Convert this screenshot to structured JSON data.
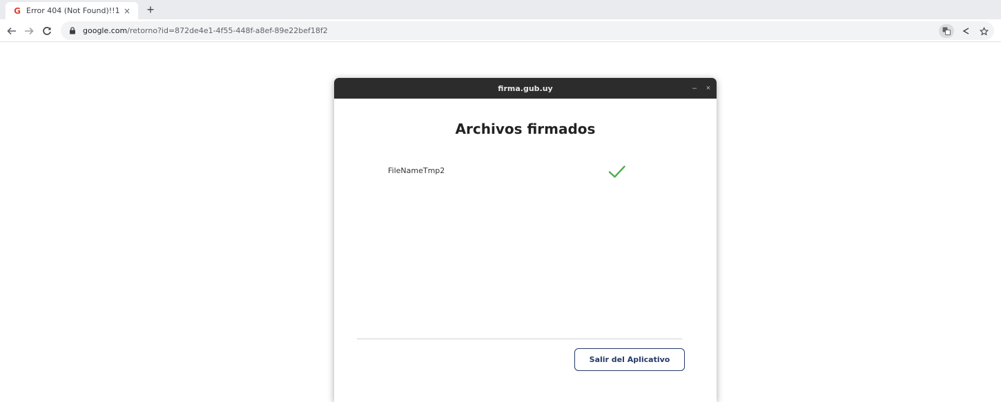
{
  "browser": {
    "tab": {
      "favicon_letter": "G",
      "title": "Error 404 (Not Found)!!1",
      "close_glyph": "×"
    },
    "new_tab_glyph": "+",
    "nav": {
      "back_icon": "arrow-left-icon",
      "forward_icon": "arrow-right-icon",
      "reload_icon": "reload-icon"
    },
    "url": {
      "host": "google.com",
      "path": "/retorno?id=872de4e1-4f55-448f-a8ef-89e22bef18f2"
    },
    "omnibox_icons": [
      "translate-icon",
      "share-icon",
      "star-icon"
    ]
  },
  "dialog": {
    "window_title": "firma.gub.uy",
    "minimize_glyph": "–",
    "close_glyph": "×",
    "heading": "Archivos firmados",
    "files": [
      {
        "name": "FileNameTmp2",
        "status": "signed",
        "status_icon": "checkmark-icon",
        "status_color": "#4caf50"
      }
    ],
    "exit_button_label": "Salir del Aplicativo",
    "accent_color": "#233a66"
  }
}
